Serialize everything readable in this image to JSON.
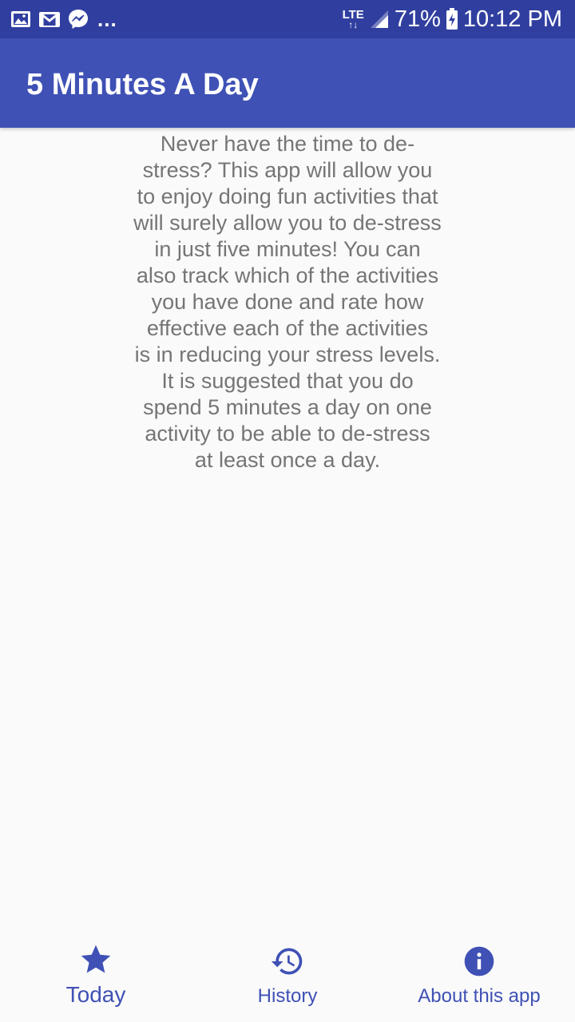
{
  "status_bar": {
    "left_icons": [
      "gallery-icon",
      "gmail-icon",
      "messenger-icon"
    ],
    "more": "...",
    "network": "LTE",
    "battery_percent": "71%",
    "time": "10:12 PM"
  },
  "app_bar": {
    "title": "5 Minutes A Day"
  },
  "content": {
    "lines": [
      "Never have the time to de-",
      "stress? This app will allow you",
      "to enjoy doing fun activities that",
      "will surely allow you to de-stress",
      "in just five minutes! You can",
      "also track which of the activities",
      "you have done and rate how",
      "effective each of the activities",
      "is in reducing your stress levels.",
      "It is suggested that you do",
      "spend 5 minutes a day on one",
      "activity to be able to de-stress",
      "at least once a day."
    ]
  },
  "bottom_nav": {
    "items": [
      {
        "label": "Today",
        "icon": "star-icon",
        "selected": true
      },
      {
        "label": "History",
        "icon": "history-icon",
        "selected": false
      },
      {
        "label": "About this app",
        "icon": "info-icon",
        "selected": false
      }
    ]
  },
  "colors": {
    "status_bar": "#303f9f",
    "primary": "#3f51b5",
    "body_text": "#757575",
    "background": "#fafafa"
  }
}
